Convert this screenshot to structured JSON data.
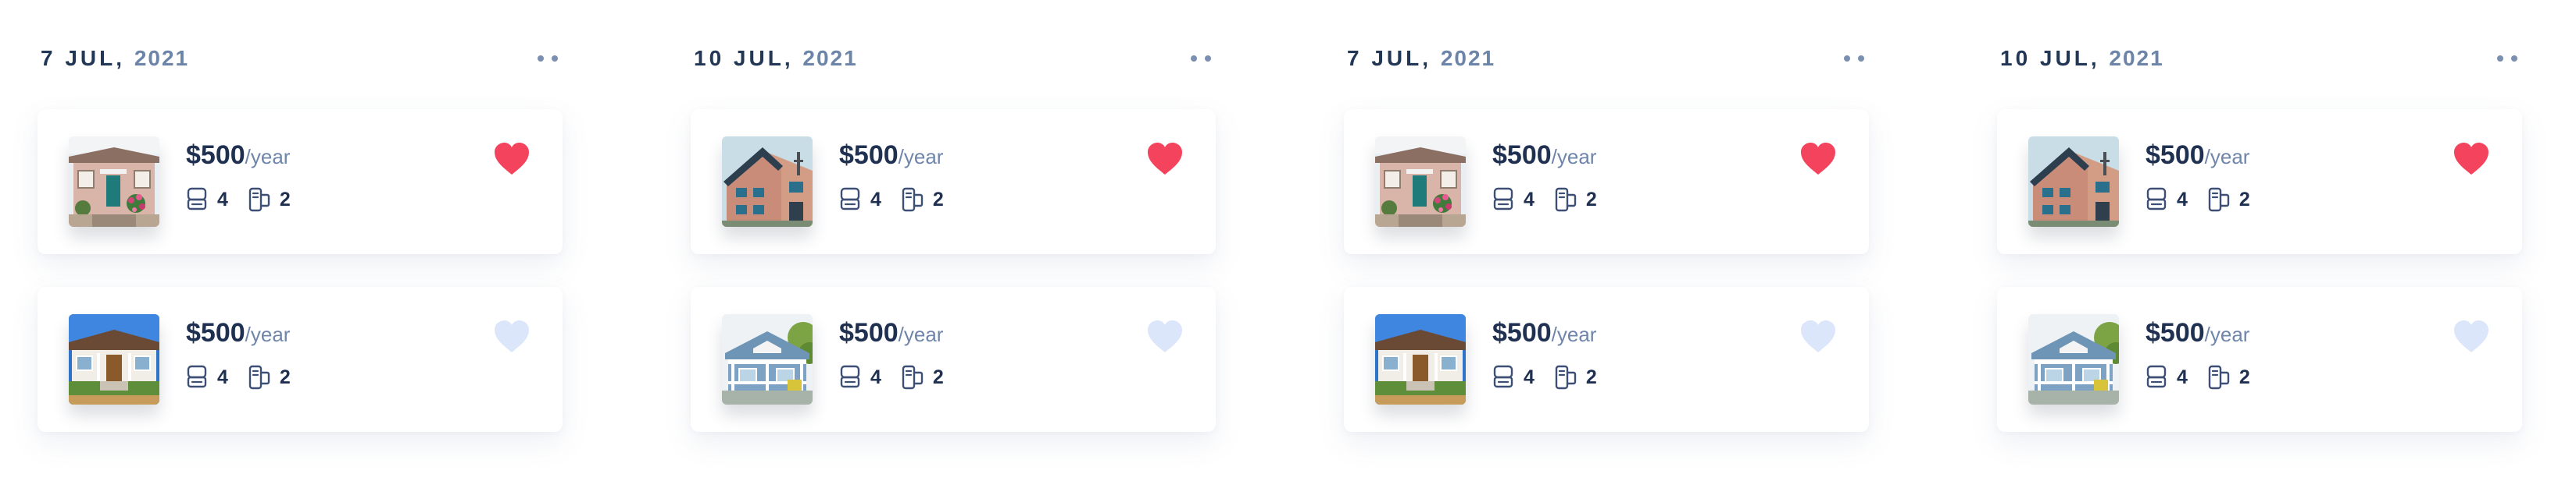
{
  "colors": {
    "heart_active": "#f4435c",
    "heart_inactive": "#dce6fb",
    "icon_stroke": "#3d4f74",
    "text_dark": "#1f3050",
    "text_muted": "#6f86aa"
  },
  "columns": [
    {
      "date": {
        "day_month": "7 JUL,",
        "year": "2021"
      },
      "listings": [
        {
          "photo": "pink-house-with-flowers",
          "price": "$500",
          "period": "/year",
          "beds": "4",
          "baths": "2",
          "favorited": true
        },
        {
          "photo": "white-bungalow-blue-sky",
          "price": "$500",
          "period": "/year",
          "beds": "4",
          "baths": "2",
          "favorited": false
        }
      ]
    },
    {
      "date": {
        "day_month": "10 JUL,",
        "year": "2021"
      },
      "listings": [
        {
          "photo": "modern-wood-house",
          "price": "$500",
          "period": "/year",
          "beds": "4",
          "baths": "2",
          "favorited": true
        },
        {
          "photo": "blue-cottage-porch",
          "price": "$500",
          "period": "/year",
          "beds": "4",
          "baths": "2",
          "favorited": false
        }
      ]
    },
    {
      "date": {
        "day_month": "7 JUL,",
        "year": "2021"
      },
      "listings": [
        {
          "photo": "pink-house-with-flowers",
          "price": "$500",
          "period": "/year",
          "beds": "4",
          "baths": "2",
          "favorited": true
        },
        {
          "photo": "white-bungalow-blue-sky",
          "price": "$500",
          "period": "/year",
          "beds": "4",
          "baths": "2",
          "favorited": false
        }
      ]
    },
    {
      "date": {
        "day_month": "10 JUL,",
        "year": "2021"
      },
      "listings": [
        {
          "photo": "modern-wood-house",
          "price": "$500",
          "period": "/year",
          "beds": "4",
          "baths": "2",
          "favorited": true
        },
        {
          "photo": "blue-cottage-porch",
          "price": "$500",
          "period": "/year",
          "beds": "4",
          "baths": "2",
          "favorited": false
        }
      ]
    }
  ]
}
